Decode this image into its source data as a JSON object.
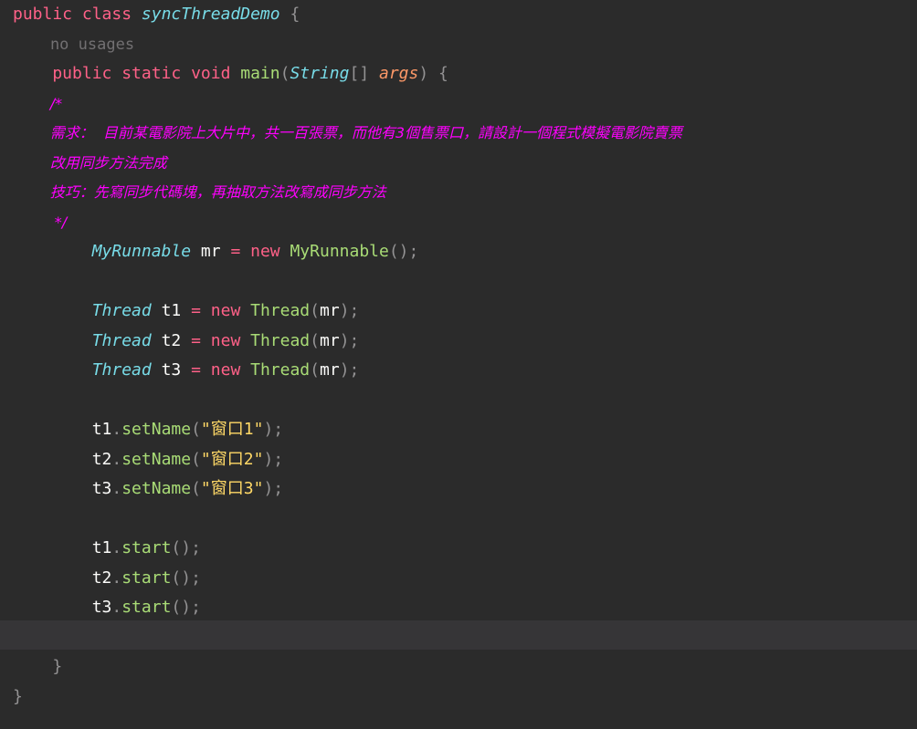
{
  "editor": {
    "lines": [
      [
        {
          "t": "public class ",
          "c": "kw"
        },
        {
          "t": "syncThreadDemo",
          "c": "cls"
        },
        {
          "t": " {",
          "c": "punc"
        }
      ],
      [
        {
          "t": "    no usages",
          "c": "hint"
        }
      ],
      [
        {
          "t": "    public static void ",
          "c": "kw"
        },
        {
          "t": "main",
          "c": "fn"
        },
        {
          "t": "(",
          "c": "punc"
        },
        {
          "t": "String",
          "c": "cls"
        },
        {
          "t": "[] ",
          "c": "punc"
        },
        {
          "t": "args",
          "c": "param"
        },
        {
          "t": ") {",
          "c": "punc"
        }
      ],
      [
        {
          "t": "        /*",
          "c": "cmt"
        }
      ],
      [
        {
          "t": "        需求：  目前某電影院上大片中，共一百張票，而他有3個售票口，請設計一個程式模擬電影院賣票",
          "c": "cmt"
        }
      ],
      [
        {
          "t": "        改用同步方法完成",
          "c": "cmt"
        }
      ],
      [
        {
          "t": "        技巧：先寫同步代碼塊，再抽取方法改寫成同步方法",
          "c": "cmt"
        }
      ],
      [
        {
          "t": "         */",
          "c": "cmt"
        }
      ],
      [
        {
          "t": "        ",
          "c": "plain"
        },
        {
          "t": "MyRunnable",
          "c": "cls"
        },
        {
          "t": " mr ",
          "c": "plain"
        },
        {
          "t": "= new ",
          "c": "kw"
        },
        {
          "t": "MyRunnable",
          "c": "fn"
        },
        {
          "t": "();",
          "c": "punc"
        }
      ],
      [],
      [
        {
          "t": "        ",
          "c": "plain"
        },
        {
          "t": "Thread",
          "c": "cls"
        },
        {
          "t": " t1 ",
          "c": "plain"
        },
        {
          "t": "= new ",
          "c": "kw"
        },
        {
          "t": "Thread",
          "c": "fn"
        },
        {
          "t": "(",
          "c": "punc"
        },
        {
          "t": "mr",
          "c": "plain"
        },
        {
          "t": ");",
          "c": "punc"
        }
      ],
      [
        {
          "t": "        ",
          "c": "plain"
        },
        {
          "t": "Thread",
          "c": "cls"
        },
        {
          "t": " t2 ",
          "c": "plain"
        },
        {
          "t": "= new ",
          "c": "kw"
        },
        {
          "t": "Thread",
          "c": "fn"
        },
        {
          "t": "(",
          "c": "punc"
        },
        {
          "t": "mr",
          "c": "plain"
        },
        {
          "t": ");",
          "c": "punc"
        }
      ],
      [
        {
          "t": "        ",
          "c": "plain"
        },
        {
          "t": "Thread",
          "c": "cls"
        },
        {
          "t": " t3 ",
          "c": "plain"
        },
        {
          "t": "= new ",
          "c": "kw"
        },
        {
          "t": "Thread",
          "c": "fn"
        },
        {
          "t": "(",
          "c": "punc"
        },
        {
          "t": "mr",
          "c": "plain"
        },
        {
          "t": ");",
          "c": "punc"
        }
      ],
      [],
      [
        {
          "t": "        t1",
          "c": "plain"
        },
        {
          "t": ".",
          "c": "punc"
        },
        {
          "t": "setName",
          "c": "fn"
        },
        {
          "t": "(",
          "c": "punc"
        },
        {
          "t": "\"窗口1\"",
          "c": "str"
        },
        {
          "t": ");",
          "c": "punc"
        }
      ],
      [
        {
          "t": "        t2",
          "c": "plain"
        },
        {
          "t": ".",
          "c": "punc"
        },
        {
          "t": "setName",
          "c": "fn"
        },
        {
          "t": "(",
          "c": "punc"
        },
        {
          "t": "\"窗口2\"",
          "c": "str"
        },
        {
          "t": ");",
          "c": "punc"
        }
      ],
      [
        {
          "t": "        t3",
          "c": "plain"
        },
        {
          "t": ".",
          "c": "punc"
        },
        {
          "t": "setName",
          "c": "fn"
        },
        {
          "t": "(",
          "c": "punc"
        },
        {
          "t": "\"窗口3\"",
          "c": "str"
        },
        {
          "t": ");",
          "c": "punc"
        }
      ],
      [],
      [
        {
          "t": "        t1",
          "c": "plain"
        },
        {
          "t": ".",
          "c": "punc"
        },
        {
          "t": "start",
          "c": "fn"
        },
        {
          "t": "();",
          "c": "punc"
        }
      ],
      [
        {
          "t": "        t2",
          "c": "plain"
        },
        {
          "t": ".",
          "c": "punc"
        },
        {
          "t": "start",
          "c": "fn"
        },
        {
          "t": "();",
          "c": "punc"
        }
      ],
      [
        {
          "t": "        t3",
          "c": "plain"
        },
        {
          "t": ".",
          "c": "punc"
        },
        {
          "t": "start",
          "c": "fn"
        },
        {
          "t": "();",
          "c": "punc"
        }
      ],
      [],
      [
        {
          "t": "    }",
          "c": "punc"
        }
      ],
      [
        {
          "t": "}",
          "c": "punc"
        }
      ]
    ]
  },
  "colors": {
    "background": "#2b2b2b",
    "keyword": "#ff6188",
    "type": "#78dce8",
    "method": "#a9dc76",
    "parameter": "#fc9867",
    "comment": "#ff00ff",
    "string": "#ffd866",
    "hint": "#727072",
    "current_line": "#363537"
  }
}
